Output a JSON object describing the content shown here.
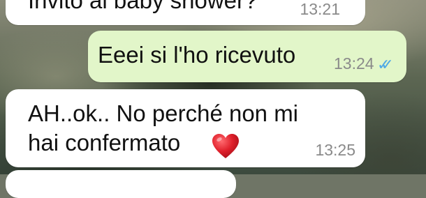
{
  "messages": [
    {
      "direction": "incoming",
      "text": "Invito al baby shower?",
      "time": "13:21"
    },
    {
      "direction": "outgoing",
      "text": "Eeei si l'ho ricevuto",
      "time": "13:24",
      "ticks": "✓✓",
      "status": "read"
    },
    {
      "direction": "incoming",
      "lines": [
        "AH..ok.. No perché non mi",
        "hai confermato"
      ],
      "emoji": "heart-icon",
      "time": "13:25"
    }
  ],
  "colors": {
    "incoming_bubble": "#ffffff",
    "outgoing_bubble": "#e2f6c9",
    "read_ticks": "#4fa9e6",
    "timestamp": "#8a8a8a",
    "heart": "#e0202b"
  }
}
